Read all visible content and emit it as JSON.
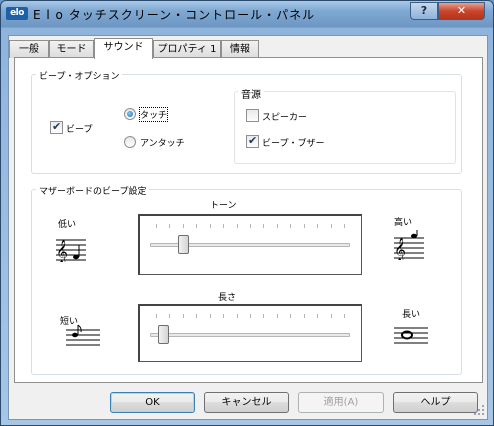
{
  "window": {
    "title": "E l o タッチスクリーン・コントロール・パネル",
    "logo": "elo",
    "help_glyph": "?",
    "close_glyph": "✕"
  },
  "tabs": [
    {
      "label": "一般"
    },
    {
      "label": "モード"
    },
    {
      "label": "サウンド",
      "active": true
    },
    {
      "label": "プロパティ 1"
    },
    {
      "label": "情報"
    }
  ],
  "beep_options": {
    "group_label": "ビープ・オプション",
    "beep": {
      "label": "ビープ",
      "checked": true
    },
    "touch_radio": {
      "label": "タッチ",
      "selected": true
    },
    "untouch_radio": {
      "label": "アンタッチ",
      "selected": false
    },
    "source": {
      "label": "音源",
      "speaker": {
        "label": "スピーカー",
        "checked": false
      },
      "buzzer": {
        "label": "ビープ・ブザー",
        "checked": true
      }
    }
  },
  "motherboard": {
    "group_label": "マザーボードのビープ設定",
    "tone": {
      "label": "トーン",
      "low": "低い",
      "high": "高い",
      "value": 0.15
    },
    "duration": {
      "label": "長さ",
      "short": "短い",
      "long": "長い",
      "value": 0.04
    }
  },
  "buttons": {
    "ok": "OK",
    "cancel": "キャンセル",
    "apply": "適用(A)",
    "help": "ヘルプ"
  },
  "colors": {
    "accent": "#1f63b3",
    "close": "#c8462c",
    "frame": "#7fa8d2"
  }
}
